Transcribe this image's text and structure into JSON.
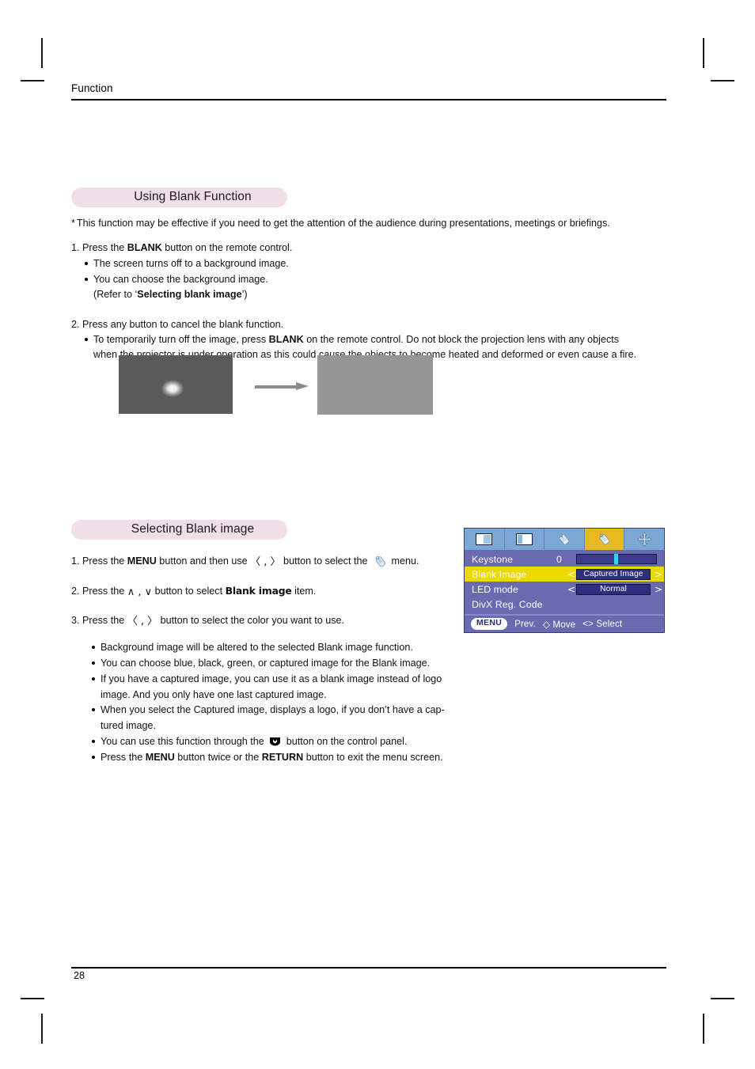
{
  "document": {
    "running_head": "Function",
    "page_number": "28"
  },
  "section1": {
    "heading": "Using Blank Function",
    "note": "This function may be effective if you need to get the attention of the audience during presentations, meetings or briefings.",
    "note_marker": "*",
    "steps": [
      {
        "number": "1.",
        "text_before": "Press the ",
        "bold": "BLANK",
        "text_after": " button on the remote control.",
        "bullets": [
          {
            "type": "bullet",
            "text": "The screen turns off to a background image."
          },
          {
            "type": "bullet",
            "text": "You can choose the background image."
          },
          {
            "type": "plain",
            "text_before": "(Refer to ‘",
            "bold": "Selecting blank image",
            "text_after": "’)"
          }
        ]
      },
      {
        "number": "2.",
        "text_before": "Press any button to cancel the blank function.",
        "bold": "",
        "text_after": "",
        "bullets": [
          {
            "type": "bullet-rich",
            "part1": "To temporarily turn off the image, press ",
            "bold": "BLANK",
            "part2": " on the remote control. Do not block the projection lens with any objects"
          },
          {
            "type": "cont",
            "text": "when the projector is under operation as this could cause the objects to become heated and deformed or even cause a fire."
          }
        ]
      }
    ],
    "illustration": {
      "photo_alt": "flower-photo",
      "arrow_alt": "right-arrow",
      "blank_alt": "blank-gray-screen",
      "blank_color": "#969696",
      "arrow_color": "#8c8c8c"
    }
  },
  "section2": {
    "heading": "Selecting Blank image",
    "steps": [
      {
        "number": "1.",
        "p1": "Press the ",
        "bold1": "MENU",
        "p2": " button and then use ",
        "nav": "〈 , 〉",
        "p3": " button to select the ",
        "icon": "tool-icon",
        "p4": " menu."
      },
      {
        "number": "2.",
        "p1": "Press the ",
        "nav": "∧ , ∨",
        "p2": " button to select ",
        "bold1": "Blank image",
        "p3": " item."
      },
      {
        "number": "3.",
        "p1": "Press the ",
        "nav": "〈 , 〉",
        "p2": " button to select the color you want to use."
      }
    ],
    "bullets": [
      {
        "type": "simple",
        "text": "Background image will be altered to the selected Blank image function."
      },
      {
        "type": "simple",
        "text": "You can choose blue, black, green, or captured image for the Blank image."
      },
      {
        "type": "simple",
        "text": "If you have a captured image, you can use it as a blank image instead of logo"
      },
      {
        "type": "cont",
        "text": "image. And you only have one last captured image."
      },
      {
        "type": "simple",
        "text": "When you select the Captured image, displays a logo, if you don’t have a cap-"
      },
      {
        "type": "cont",
        "text": "tured image."
      },
      {
        "type": "icon",
        "part1": "You can use this function through the ",
        "icon": "blank-button-icon",
        "part2": " button on the control panel."
      },
      {
        "type": "rich2",
        "part1": "Press the ",
        "bold1": "MENU",
        "part2": " button twice or the ",
        "bold2": "RETURN",
        "part3": " button to exit the menu screen."
      }
    ]
  },
  "osd": {
    "tabs": [
      {
        "name": "picture-tab",
        "icon": "screen-icon",
        "selected": false
      },
      {
        "name": "screen-tab",
        "icon": "screen-split-icon",
        "selected": false
      },
      {
        "name": "audio-tab",
        "icon": "tool-icon",
        "selected": false
      },
      {
        "name": "function-tab",
        "icon": "tool-icon",
        "selected": true
      },
      {
        "name": "navigation-tab",
        "icon": "four-arrows-icon",
        "selected": false
      }
    ],
    "rows": [
      {
        "label": "Keystone",
        "value": "0",
        "control": "slider",
        "highlight": false
      },
      {
        "label": "Blank Image",
        "value": "Captured Image",
        "control": "option",
        "highlight": true
      },
      {
        "label": "LED mode",
        "value": "Normal",
        "control": "option",
        "highlight": false
      },
      {
        "label": "DivX Reg. Code",
        "value": "",
        "control": "none",
        "highlight": false
      }
    ],
    "footer": {
      "menu_label": "MENU",
      "prev_label": "Prev.",
      "move_glyph": "◇",
      "move_label": "Move",
      "select_glyph": "<>",
      "select_label": "Select"
    },
    "colors": {
      "panel": "#6a6ab0",
      "tabbar": "#7ba7d4",
      "tab_selected": "#e8b820",
      "row_highlight": "#ecd900",
      "option_box": "#2e2e7e",
      "slider_thumb": "#3fd0e8"
    }
  }
}
